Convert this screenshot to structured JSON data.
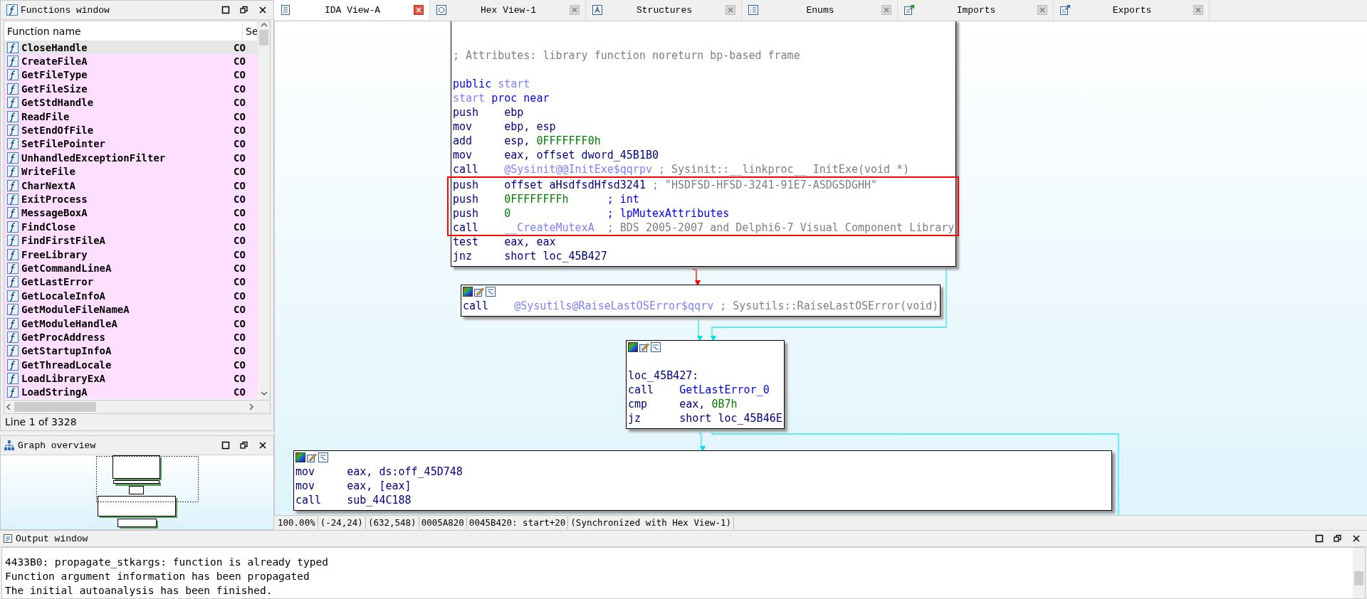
{
  "functions_window": {
    "title": "Functions window",
    "columns": [
      "Function name",
      "Se"
    ],
    "rows": [
      {
        "name": "CloseHandle",
        "segment": "CO",
        "selected": true
      },
      {
        "name": "CreateFileA",
        "segment": "CO",
        "selected": false
      },
      {
        "name": "GetFileType",
        "segment": "CO",
        "selected": false
      },
      {
        "name": "GetFileSize",
        "segment": "CO",
        "selected": false
      },
      {
        "name": "GetStdHandle",
        "segment": "CO",
        "selected": false
      },
      {
        "name": "ReadFile",
        "segment": "CO",
        "selected": false
      },
      {
        "name": "SetEndOfFile",
        "segment": "CO",
        "selected": false
      },
      {
        "name": "SetFilePointer",
        "segment": "CO",
        "selected": false
      },
      {
        "name": "UnhandledExceptionFilter",
        "segment": "CO",
        "selected": false
      },
      {
        "name": "WriteFile",
        "segment": "CO",
        "selected": false
      },
      {
        "name": "CharNextA",
        "segment": "CO",
        "selected": false
      },
      {
        "name": "ExitProcess",
        "segment": "CO",
        "selected": false
      },
      {
        "name": "MessageBoxA",
        "segment": "CO",
        "selected": false
      },
      {
        "name": "FindClose",
        "segment": "CO",
        "selected": false
      },
      {
        "name": "FindFirstFileA",
        "segment": "CO",
        "selected": false
      },
      {
        "name": "FreeLibrary",
        "segment": "CO",
        "selected": false
      },
      {
        "name": "GetCommandLineA",
        "segment": "CO",
        "selected": false
      },
      {
        "name": "GetLastError",
        "segment": "CO",
        "selected": false
      },
      {
        "name": "GetLocaleInfoA",
        "segment": "CO",
        "selected": false
      },
      {
        "name": "GetModuleFileNameA",
        "segment": "CO",
        "selected": false
      },
      {
        "name": "GetModuleHandleA",
        "segment": "CO",
        "selected": false
      },
      {
        "name": "GetProcAddress",
        "segment": "CO",
        "selected": false
      },
      {
        "name": "GetStartupInfoA",
        "segment": "CO",
        "selected": false
      },
      {
        "name": "GetThreadLocale",
        "segment": "CO",
        "selected": false
      },
      {
        "name": "LoadLibraryExA",
        "segment": "CO",
        "selected": false
      },
      {
        "name": "LoadStringA",
        "segment": "CO",
        "selected": false
      }
    ],
    "status": "Line 1 of 3328"
  },
  "graph_overview": {
    "title": "Graph overview"
  },
  "tabs": [
    {
      "label": "IDA View-A",
      "selected": true
    },
    {
      "label": "Hex View-1",
      "selected": false
    },
    {
      "label": "Structures",
      "selected": false
    },
    {
      "label": "Enums",
      "selected": false
    },
    {
      "label": "Imports",
      "selected": false
    },
    {
      "label": "Exports",
      "selected": false
    }
  ],
  "graph": {
    "blocks": [
      {
        "sections": [
          {
            "highlighted": false,
            "lines": [
              {
                "kind": "blank"
              },
              {
                "kind": "blank"
              },
              {
                "kind": "comment",
                "text": "; Attributes: library function noreturn bp-based frame"
              },
              {
                "kind": "blank"
              },
              {
                "kind": "directive",
                "segments": [
                  {
                    "text": "public",
                    "kind": "keyword"
                  },
                  {
                    "text": "start",
                    "kind": "name"
                  }
                ]
              },
              {
                "kind": "directive",
                "segments": [
                  {
                    "text": "start",
                    "kind": "name"
                  },
                  {
                    "text": "proc near",
                    "kind": "keyword"
                  }
                ]
              },
              {
                "kind": "instruction",
                "mnemonic": "push",
                "operands": [
                  {
                    "text": "ebp",
                    "kind": "operand"
                  }
                ]
              },
              {
                "kind": "instruction",
                "mnemonic": "mov",
                "operands": [
                  {
                    "text": "ebp, esp",
                    "kind": "operand"
                  }
                ]
              },
              {
                "kind": "instruction",
                "mnemonic": "add",
                "operands": [
                  {
                    "text": "esp, ",
                    "kind": "operand"
                  },
                  {
                    "text": "0FFFFFFF0h",
                    "kind": "number"
                  }
                ]
              },
              {
                "kind": "instruction",
                "mnemonic": "mov",
                "operands": [
                  {
                    "text": "eax, offset dword_45B1B0",
                    "kind": "operand"
                  }
                ]
              },
              {
                "kind": "instruction",
                "mnemonic": "call",
                "operands": [
                  {
                    "text": "@Sysinit@@InitExe$qqrpv",
                    "kind": "name"
                  }
                ],
                "comment": {
                  "text": "; Sysinit::__linkproc__ InitExe(void *)",
                  "kind": "auto"
                }
              }
            ]
          },
          {
            "highlighted": true,
            "lines": [
              {
                "kind": "instruction",
                "mnemonic": "push",
                "operands": [
                  {
                    "text": "offset aHsdfsdHfsd3241",
                    "kind": "operand"
                  }
                ],
                "comment": {
                  "text": "; \"HSDFSD-HFSD-3241-91E7-ASDGSDGHH\"",
                  "kind": "auto"
                }
              },
              {
                "kind": "instruction",
                "mnemonic": "push",
                "operands": [
                  {
                    "text": "0FFFFFFFFh",
                    "kind": "number"
                  }
                ],
                "comment": {
                  "text": "; int",
                  "kind": "argument"
                }
              },
              {
                "kind": "instruction",
                "mnemonic": "push",
                "operands": [
                  {
                    "text": "0",
                    "kind": "number"
                  }
                ],
                "comment": {
                  "text": "; lpMutexAttributes",
                  "kind": "argument"
                }
              },
              {
                "kind": "instruction",
                "mnemonic": "call",
                "operands": [
                  {
                    "text": "__CreateMutexA",
                    "kind": "name"
                  }
                ],
                "comment": {
                  "text": "; BDS 2005-2007 and Delphi6-7 Visual Component Library",
                  "kind": "auto"
                }
              }
            ]
          },
          {
            "highlighted": false,
            "lines": [
              {
                "kind": "instruction",
                "mnemonic": "test",
                "operands": [
                  {
                    "text": "eax, eax",
                    "kind": "operand"
                  }
                ]
              },
              {
                "kind": "instruction",
                "mnemonic": "jnz",
                "operands": [
                  {
                    "text": "short loc_45B427",
                    "kind": "operand"
                  }
                ]
              }
            ]
          }
        ]
      },
      {
        "lines": [
          {
            "kind": "instruction",
            "mnemonic": "call",
            "operands": [
              {
                "text": "@Sysutils@RaiseLastOSError$qqrv",
                "kind": "name"
              }
            ],
            "comment": {
              "text": "; Sysutils::RaiseLastOSError(void)",
              "kind": "auto"
            }
          }
        ]
      },
      {
        "lines": [
          {
            "kind": "blank"
          },
          {
            "kind": "label",
            "text": "loc_45B427:"
          },
          {
            "kind": "instruction",
            "mnemonic": "call",
            "operands": [
              {
                "text": "GetLastError_0",
                "kind": "name_dark"
              }
            ]
          },
          {
            "kind": "instruction",
            "mnemonic": "cmp",
            "operands": [
              {
                "text": "eax, ",
                "kind": "operand"
              },
              {
                "text": "0B7h",
                "kind": "number"
              }
            ]
          },
          {
            "kind": "instruction",
            "mnemonic": "jz",
            "operands": [
              {
                "text": "short loc_45B46E",
                "kind": "operand"
              }
            ]
          }
        ]
      },
      {
        "lines": [
          {
            "kind": "instruction",
            "mnemonic": "mov",
            "operands": [
              {
                "text": "eax, ds:off_45D748",
                "kind": "operand"
              }
            ]
          },
          {
            "kind": "instruction",
            "mnemonic": "mov",
            "operands": [
              {
                "text": "eax, [eax]",
                "kind": "operand"
              }
            ]
          },
          {
            "kind": "instruction",
            "mnemonic": "call",
            "operands": [
              {
                "text": "sub_44C188",
                "kind": "operand"
              }
            ]
          }
        ]
      }
    ]
  },
  "status_bar": [
    "100.00%",
    "(-24,24)",
    "(632,548)",
    "0005A820",
    "0045B420: start+20",
    "(Synchronized with Hex View-1)"
  ],
  "output_window": {
    "title": "Output window",
    "lines": [
      "4433B0: propagate_stkargs: function is already typed",
      "Function argument information has been propagated",
      "The initial autoanalysis has been finished."
    ]
  }
}
